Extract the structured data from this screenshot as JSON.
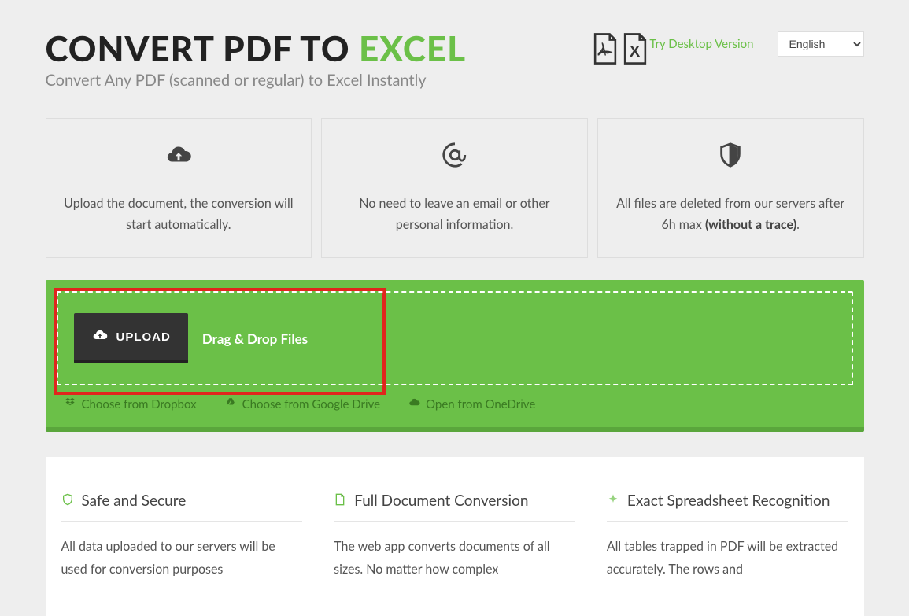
{
  "header": {
    "title_part1": "CONVERT PDF TO ",
    "title_part2": "EXCEL",
    "subtitle": "Convert Any PDF (scanned or regular) to Excel Instantly",
    "try_link": "Try Desktop Version",
    "language": "English"
  },
  "cards": [
    {
      "text": "Upload the document, the conversion will start automatically."
    },
    {
      "text": "No need to leave an email or other personal information."
    },
    {
      "text_a": "All files are deleted from our servers after 6h max ",
      "text_b": "(without a trace)",
      "text_c": "."
    }
  ],
  "upload": {
    "button": "UPLOAD",
    "drag_text": "Drag & Drop Files",
    "cloud": [
      {
        "label": "Choose from Dropbox"
      },
      {
        "label": "Choose from Google Drive"
      },
      {
        "label": "Open from OneDrive"
      }
    ]
  },
  "features": [
    {
      "title": "Safe and Secure",
      "body": "All data uploaded to our servers will be used for conversion purposes"
    },
    {
      "title": "Full Document Conversion",
      "body": "The web app converts documents of all sizes. No matter how complex"
    },
    {
      "title": "Exact Spreadsheet Recognition",
      "body": "All tables trapped in PDF will be extracted accurately. The rows and"
    }
  ]
}
